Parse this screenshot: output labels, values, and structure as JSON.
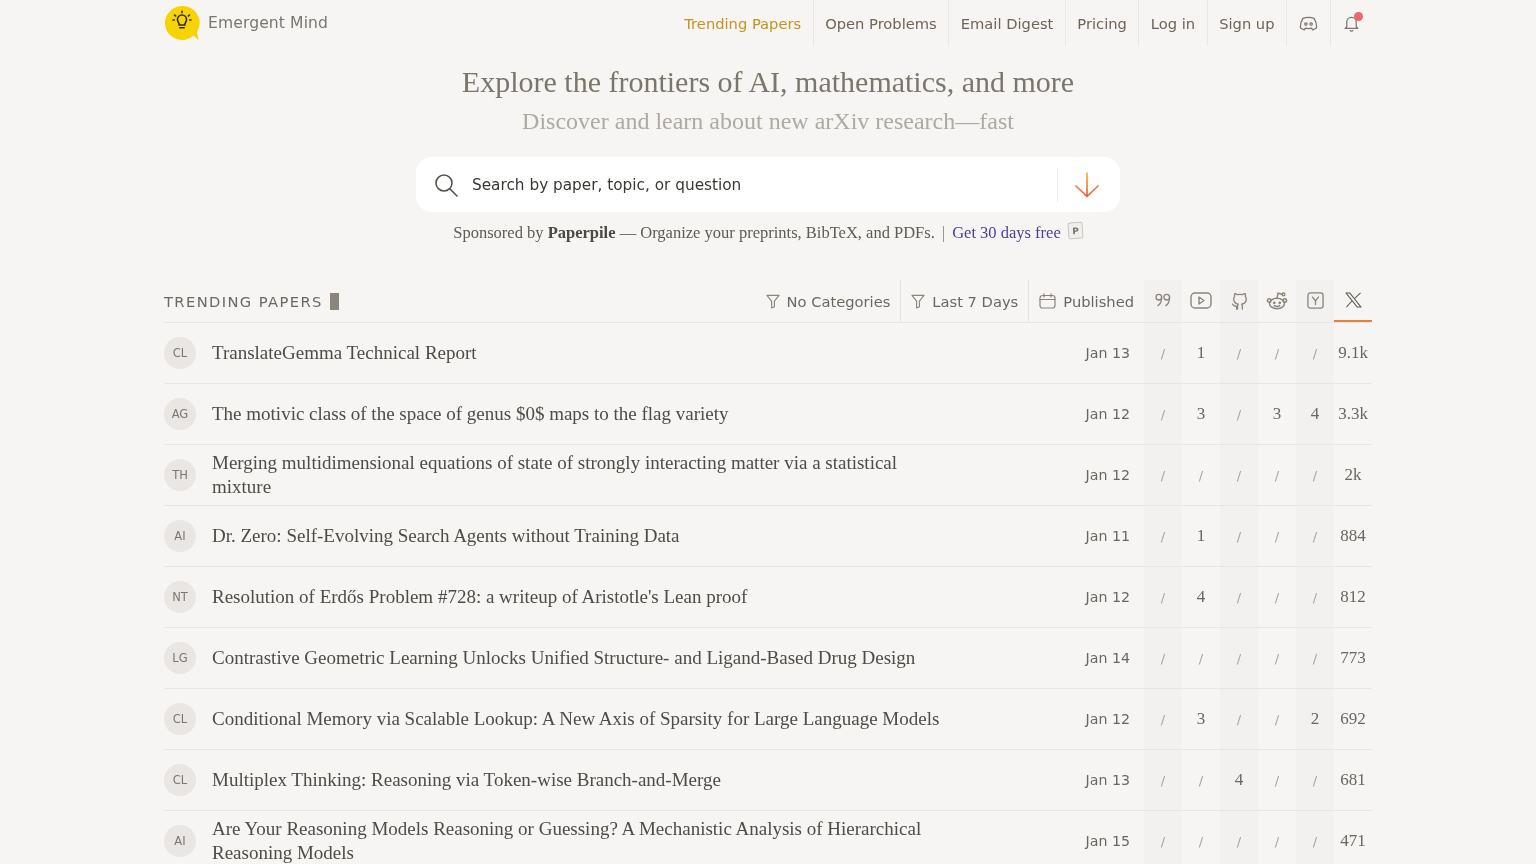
{
  "header": {
    "brand": "Emergent Mind",
    "nav": [
      {
        "label": "Trending Papers",
        "selected": true
      },
      {
        "label": "Open Problems",
        "selected": false
      },
      {
        "label": "Email Digest",
        "selected": false
      },
      {
        "label": "Pricing",
        "selected": false
      },
      {
        "label": "Log in",
        "selected": false
      },
      {
        "label": "Sign up",
        "selected": false
      }
    ],
    "bell": {
      "unread": true
    }
  },
  "hero": {
    "title": "Explore the frontiers of AI, mathematics, and more",
    "subtitle": "Discover and learn about new arXiv research—fast"
  },
  "search": {
    "placeholder": "Search by paper, topic, or question"
  },
  "sponsor": {
    "text": "Sponsored by **Paperpile** — Organize your preprints, BibTeX, and PDFs.",
    "separator": "|",
    "link": "Get 30 days free",
    "logo_letter": "P"
  },
  "trending": {
    "heading": "TRENDING PAPERS",
    "filters": [
      {
        "kind": "filter",
        "label": "No Categories"
      },
      {
        "kind": "filter",
        "label": "Last 7 Days"
      },
      {
        "kind": "date",
        "label": "Published"
      }
    ],
    "sort_columns": [
      {
        "kind": "quote",
        "selected": false
      },
      {
        "kind": "video",
        "selected": false
      },
      {
        "kind": "code",
        "selected": false
      },
      {
        "kind": "forum",
        "selected": false
      },
      {
        "kind": "news",
        "selected": false
      },
      {
        "kind": "post",
        "selected": true
      }
    ],
    "rows": [
      {
        "category": "CL",
        "title": "TranslateGemma Technical Report",
        "date": "Jan 13",
        "cells": [
          {
            "kind": "none",
            "text": "/"
          },
          {
            "kind": "count",
            "text": "1"
          },
          {
            "kind": "none",
            "text": "/"
          },
          {
            "kind": "none",
            "text": "/"
          },
          {
            "kind": "none",
            "text": "/"
          },
          {
            "kind": "count",
            "text": "9.1k"
          }
        ]
      },
      {
        "category": "AG",
        "title": "The motivic class of the space of genus $0$ maps to the flag variety",
        "date": "Jan 12",
        "cells": [
          {
            "kind": "none",
            "text": "/"
          },
          {
            "kind": "count",
            "text": "3"
          },
          {
            "kind": "none",
            "text": "/"
          },
          {
            "kind": "count",
            "text": "3"
          },
          {
            "kind": "count",
            "text": "4"
          },
          {
            "kind": "count",
            "text": "3.3k"
          }
        ]
      },
      {
        "category": "TH",
        "title": "Merging multidimensional equations of state of strongly interacting matter via a statistical mixture",
        "date": "Jan 12",
        "cells": [
          {
            "kind": "none",
            "text": "/"
          },
          {
            "kind": "none",
            "text": "/"
          },
          {
            "kind": "none",
            "text": "/"
          },
          {
            "kind": "none",
            "text": "/"
          },
          {
            "kind": "none",
            "text": "/"
          },
          {
            "kind": "count",
            "text": "2k"
          }
        ]
      },
      {
        "category": "AI",
        "title": "Dr. Zero: Self-Evolving Search Agents without Training Data",
        "date": "Jan 11",
        "cells": [
          {
            "kind": "none",
            "text": "/"
          },
          {
            "kind": "count",
            "text": "1"
          },
          {
            "kind": "none",
            "text": "/"
          },
          {
            "kind": "none",
            "text": "/"
          },
          {
            "kind": "none",
            "text": "/"
          },
          {
            "kind": "count",
            "text": "884"
          }
        ]
      },
      {
        "category": "NT",
        "title": "Resolution of Erdős Problem #728: a writeup of Aristotle's Lean proof",
        "date": "Jan 12",
        "cells": [
          {
            "kind": "none",
            "text": "/"
          },
          {
            "kind": "count",
            "text": "4"
          },
          {
            "kind": "none",
            "text": "/"
          },
          {
            "kind": "none",
            "text": "/"
          },
          {
            "kind": "none",
            "text": "/"
          },
          {
            "kind": "count",
            "text": "812"
          }
        ]
      },
      {
        "category": "LG",
        "title": "Contrastive Geometric Learning Unlocks Unified Structure- and Ligand-Based Drug Design",
        "date": "Jan 14",
        "cells": [
          {
            "kind": "none",
            "text": "/"
          },
          {
            "kind": "none",
            "text": "/"
          },
          {
            "kind": "none",
            "text": "/"
          },
          {
            "kind": "none",
            "text": "/"
          },
          {
            "kind": "none",
            "text": "/"
          },
          {
            "kind": "count",
            "text": "773"
          }
        ]
      },
      {
        "category": "CL",
        "title": "Conditional Memory via Scalable Lookup: A New Axis of Sparsity for Large Language Models",
        "date": "Jan 12",
        "cells": [
          {
            "kind": "none",
            "text": "/"
          },
          {
            "kind": "count",
            "text": "3"
          },
          {
            "kind": "none",
            "text": "/"
          },
          {
            "kind": "none",
            "text": "/"
          },
          {
            "kind": "count",
            "text": "2"
          },
          {
            "kind": "count",
            "text": "692"
          }
        ]
      },
      {
        "category": "CL",
        "title": "Multiplex Thinking: Reasoning via Token-wise Branch-and-Merge",
        "date": "Jan 13",
        "cells": [
          {
            "kind": "none",
            "text": "/"
          },
          {
            "kind": "none",
            "text": "/"
          },
          {
            "kind": "count",
            "text": "4"
          },
          {
            "kind": "none",
            "text": "/"
          },
          {
            "kind": "none",
            "text": "/"
          },
          {
            "kind": "count",
            "text": "681"
          }
        ]
      },
      {
        "category": "AI",
        "title": "Are Your Reasoning Models Reasoning or Guessing? A Mechanistic Analysis of Hierarchical Reasoning Models",
        "date": "Jan 15",
        "cells": [
          {
            "kind": "none",
            "text": "/"
          },
          {
            "kind": "none",
            "text": "/"
          },
          {
            "kind": "none",
            "text": "/"
          },
          {
            "kind": "none",
            "text": "/"
          },
          {
            "kind": "none",
            "text": "/"
          },
          {
            "kind": "count",
            "text": "471"
          }
        ]
      }
    ]
  }
}
